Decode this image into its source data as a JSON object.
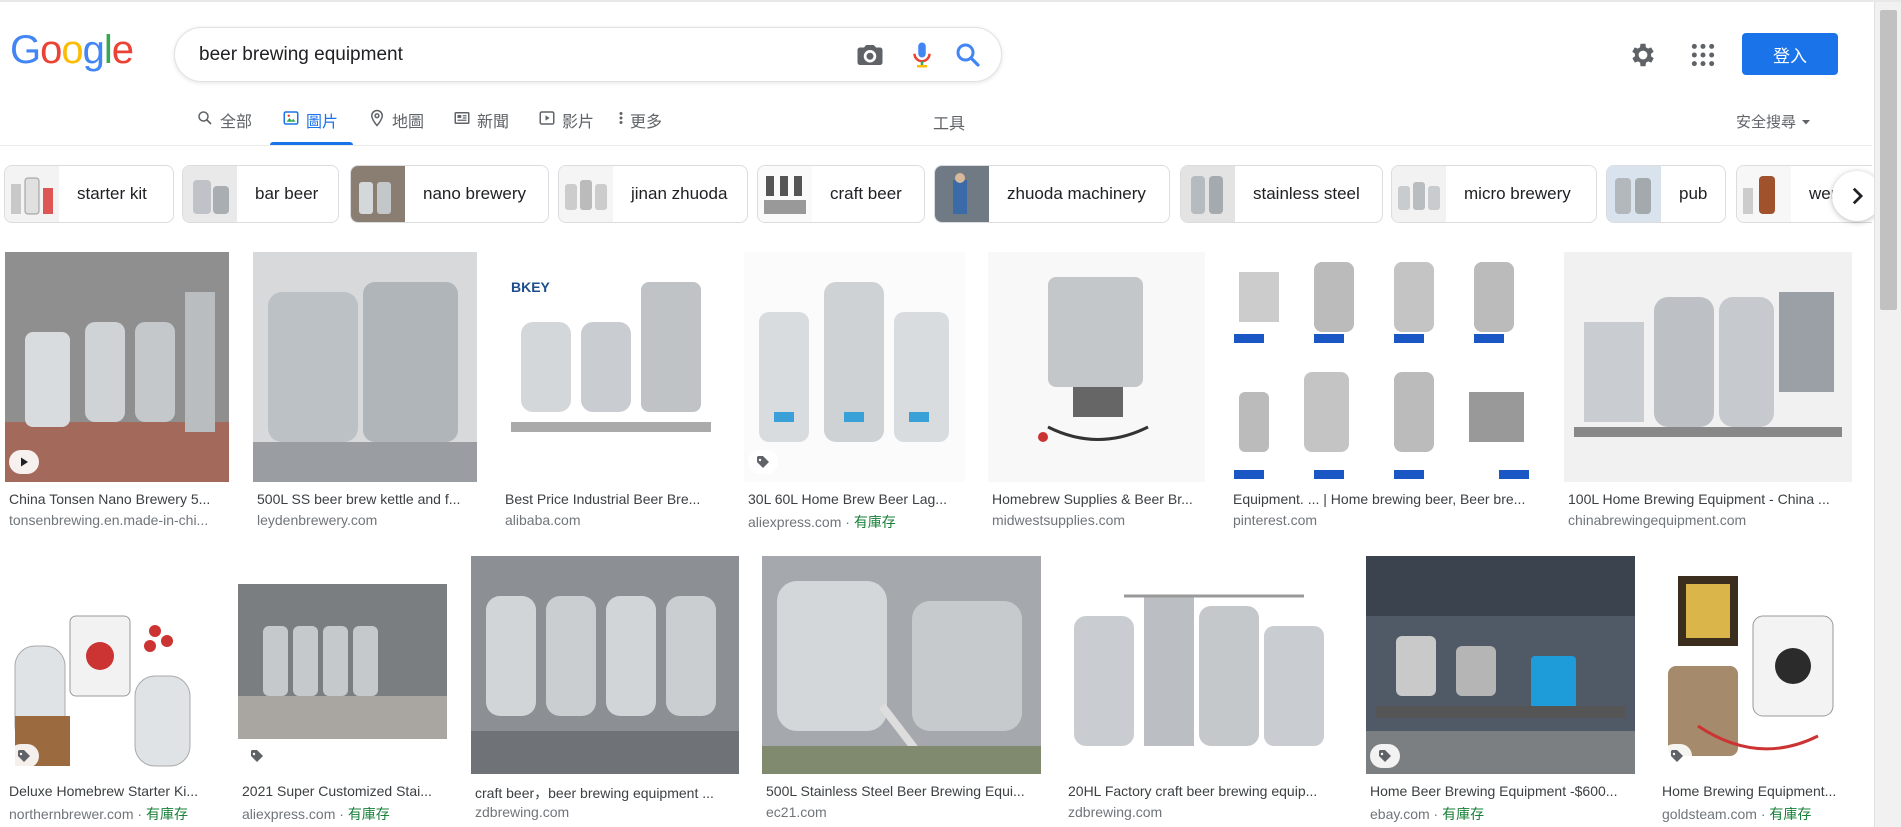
{
  "logo": {
    "letters": [
      "G",
      "o",
      "o",
      "g",
      "l",
      "e"
    ],
    "colors": [
      "#4285F4",
      "#EA4335",
      "#FBBC05",
      "#4285F4",
      "#34A853",
      "#EA4335"
    ]
  },
  "search": {
    "query": "beer brewing equipment",
    "icons": [
      "camera-icon",
      "microphone-icon",
      "search-icon"
    ]
  },
  "header": {
    "signin_label": "登入",
    "icons": [
      "gear-icon",
      "apps-grid-icon"
    ]
  },
  "tabs": [
    {
      "label": "全部",
      "icon": "search-icon",
      "active": false
    },
    {
      "label": "圖片",
      "icon": "image-icon",
      "active": true
    },
    {
      "label": "地圖",
      "icon": "map-pin-icon",
      "active": false
    },
    {
      "label": "新聞",
      "icon": "news-icon",
      "active": false
    },
    {
      "label": "影片",
      "icon": "video-icon",
      "active": false
    },
    {
      "label": "更多",
      "icon": "more-vert-icon",
      "active": false
    }
  ],
  "tools_label": "工具",
  "safesearch_label": "安全搜尋",
  "chips": [
    {
      "label": "starter kit"
    },
    {
      "label": "bar beer"
    },
    {
      "label": "nano brewery"
    },
    {
      "label": "jinan zhuoda"
    },
    {
      "label": "craft beer"
    },
    {
      "label": "zhuoda machinery"
    },
    {
      "label": "stainless steel"
    },
    {
      "label": "micro brewery"
    },
    {
      "label": "pub"
    },
    {
      "label": "wert"
    }
  ],
  "results_row1": [
    {
      "caption": "China Tonsen Nano Brewery 5...",
      "source": "tonsenbrewing.en.made-in-chi...",
      "in_stock": "",
      "badge": "play-icon"
    },
    {
      "caption": "500L SS beer brew kettle and f...",
      "source": "leydenbrewery.com",
      "in_stock": "",
      "badge": ""
    },
    {
      "caption": "Best Price Industrial Beer Bre...",
      "source": "alibaba.com",
      "in_stock": "",
      "badge": ""
    },
    {
      "caption": "30L 60L Home Brew Beer Lag...",
      "source": "aliexpress.com · ",
      "in_stock": "有庫存",
      "badge": "tag-icon"
    },
    {
      "caption": "Homebrew Supplies & Beer Br...",
      "source": "midwestsupplies.com",
      "in_stock": "",
      "badge": ""
    },
    {
      "caption": "Equipment. ... | Home brewing beer, Beer bre...",
      "source": "pinterest.com",
      "in_stock": "",
      "badge": ""
    },
    {
      "caption": "100L Home Brewing Equipment - China ...",
      "source": "chinabrewingequipment.com",
      "in_stock": "",
      "badge": ""
    }
  ],
  "results_row2": [
    {
      "caption": "Deluxe Homebrew Starter Ki...",
      "source": "northernbrewer.com · ",
      "in_stock": "有庫存",
      "badge": "tag-icon"
    },
    {
      "caption": "2021 Super Customized Stai...",
      "source": "aliexpress.com · ",
      "in_stock": "有庫存",
      "badge": "tag-icon"
    },
    {
      "caption": "craft beer，beer brewing equipment ...",
      "source": "zdbrewing.com",
      "in_stock": "",
      "badge": ""
    },
    {
      "caption": "500L Stainless Steel Beer Brewing Equi...",
      "source": "ec21.com",
      "in_stock": "",
      "badge": ""
    },
    {
      "caption": "20HL Factory craft beer brewing equip...",
      "source": "zdbrewing.com",
      "in_stock": "",
      "badge": ""
    },
    {
      "caption": "Home Beer Brewing Equipment -$600...",
      "source": "ebay.com · ",
      "in_stock": "有庫存",
      "badge": "tag-icon"
    },
    {
      "caption": "Home Brewing Equipment...",
      "source": "goldsteam.com · ",
      "in_stock": "有庫存",
      "badge": "tag-icon"
    }
  ],
  "colors": {
    "accent": "#1a73e8",
    "stock_green": "#188038",
    "text_secondary": "#70757a"
  }
}
